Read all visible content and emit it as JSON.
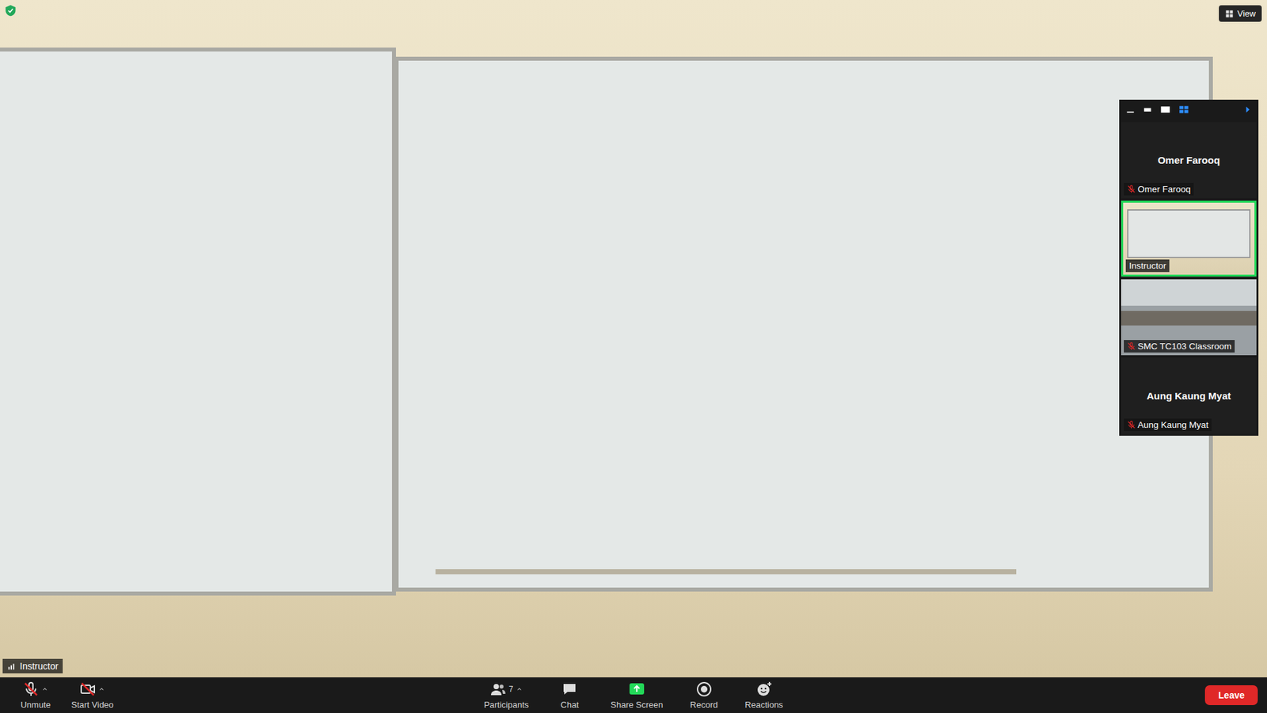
{
  "top_bar": {
    "view_button": "View"
  },
  "active_speaker": {
    "label": "Instructor"
  },
  "gallery": {
    "tiles": [
      {
        "kind": "name",
        "name": "Omer Farooq",
        "label": "Omer Farooq",
        "muted": true,
        "selected": false
      },
      {
        "kind": "video",
        "label": "Instructor",
        "muted": false,
        "selected": true
      },
      {
        "kind": "video",
        "label": "SMC TC103 Classroom",
        "muted": true,
        "selected": false
      },
      {
        "kind": "name",
        "name": "Aung Kaung Myat",
        "label": "Aung Kaung Myat",
        "muted": true,
        "selected": false
      }
    ]
  },
  "toolbar": {
    "left": [
      {
        "kind": "mic",
        "label": "Unmute",
        "off": true
      },
      {
        "kind": "camera",
        "label": "Start Video",
        "off": true
      }
    ],
    "center": [
      {
        "kind": "participants",
        "label": "Participants",
        "count": "7"
      },
      {
        "kind": "chat",
        "label": "Chat"
      },
      {
        "kind": "share",
        "label": "Share Screen"
      },
      {
        "kind": "record",
        "label": "Record"
      },
      {
        "kind": "reactions",
        "label": "Reactions"
      }
    ],
    "leave": "Leave"
  }
}
